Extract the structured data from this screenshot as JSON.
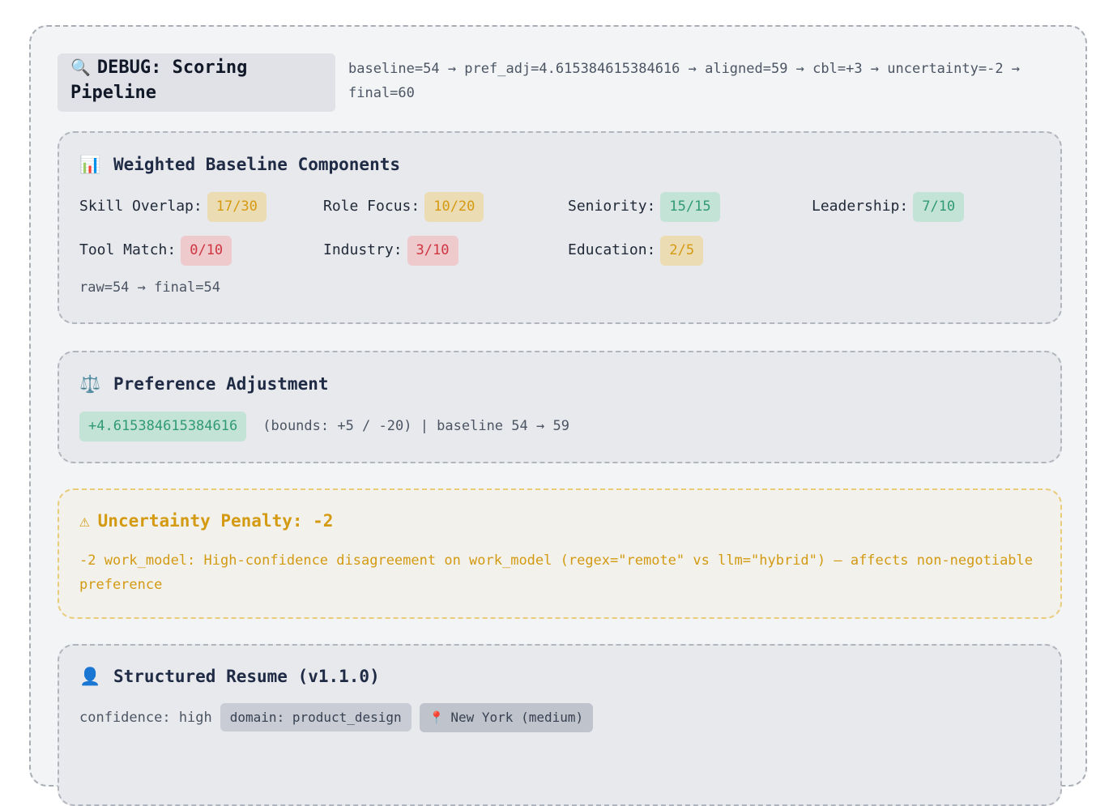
{
  "debug": {
    "icon": "🔍",
    "title": "DEBUG: Scoring Pipeline",
    "pipeline": "baseline=54 → pref_adj=4.615384615384616 → aligned=59 → cbl=+3 → uncertainty=-2 → final=60"
  },
  "baseline": {
    "icon": "📊",
    "title": "Weighted Baseline Components",
    "components": [
      {
        "label": "Skill Overlap:",
        "value": "17/30",
        "tone": "yellow"
      },
      {
        "label": "Role Focus:",
        "value": "10/20",
        "tone": "yellow"
      },
      {
        "label": "Seniority:",
        "value": "15/15",
        "tone": "green"
      },
      {
        "label": "Leadership:",
        "value": "7/10",
        "tone": "green"
      },
      {
        "label": "Tool Match:",
        "value": "0/10",
        "tone": "red"
      },
      {
        "label": "Industry:",
        "value": "3/10",
        "tone": "red"
      },
      {
        "label": "Education:",
        "value": "2/5",
        "tone": "yellow"
      }
    ],
    "raw_line": "raw=54 → final=54"
  },
  "preference": {
    "icon": "⚖️",
    "title": "Preference Adjustment",
    "value": "+4.615384615384616",
    "detail": "(bounds: +5 / -20) | baseline 54 → 59"
  },
  "uncertainty": {
    "icon": "⚠",
    "title": "Uncertainty Penalty: -2",
    "text": "-2 work_model: High-confidence disagreement on work_model (regex=\"remote\" vs llm=\"hybrid\") — affects non-negotiable preference"
  },
  "resume": {
    "icon": "👤",
    "title": "Structured Resume (v1.1.0)",
    "confidence": "confidence: high",
    "domain_tag": "domain: product_design",
    "location_icon": "📍",
    "location": "New York (medium)"
  },
  "colors": {
    "yellow_fg": "#d59a12",
    "green_fg": "#2f9a73",
    "red_fg": "#cf3540",
    "title_fg": "#1f2a44"
  }
}
